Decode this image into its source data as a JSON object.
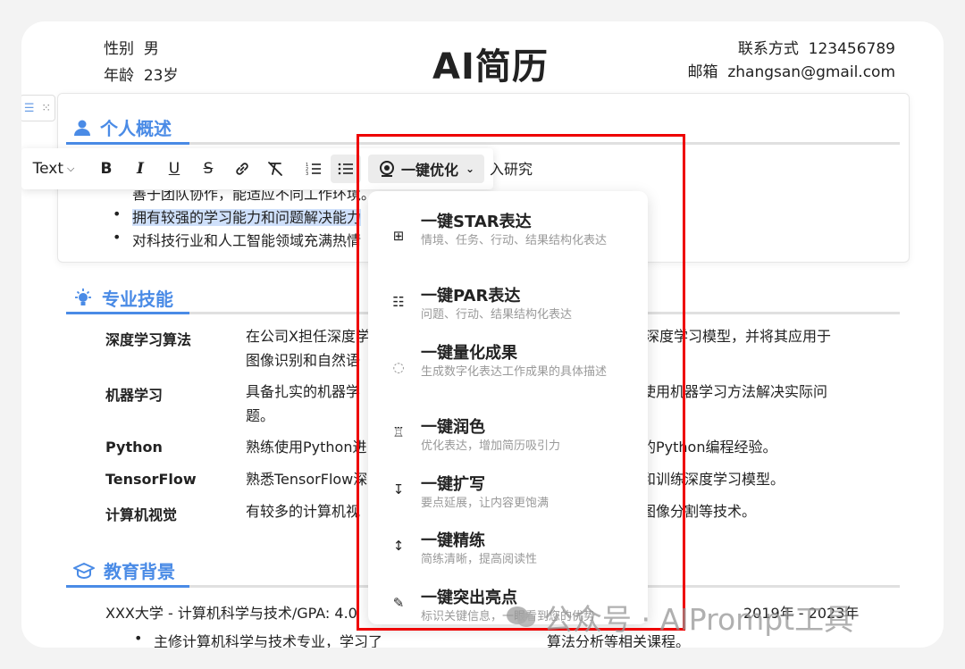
{
  "header": {
    "gender_label": "性别",
    "gender_value": "男",
    "age_label": "年龄",
    "age_value": "23岁",
    "title": "AI简历",
    "contact_label": "联系方式",
    "contact_value": "123456789",
    "email_label": "邮箱",
    "email_value": "zhangsan@gmail.com"
  },
  "block_handle": {
    "icon_a": "☰",
    "icon_b": "⁙"
  },
  "section_personal": {
    "title": "个人概述",
    "bullet_partial_top": "入研究",
    "bullets": [
      "善于团队协作，能适应不同工作环境。",
      "拥有较强的学习能力和问题解决能力",
      "对科技行业和人工智能领域充满热情"
    ]
  },
  "toolbar": {
    "text_label": "Text",
    "bold": "B",
    "italic": "I",
    "underline": "U",
    "strike": "S",
    "link_icon": "link-icon",
    "clear_icon": "clear-format-icon",
    "ordered_icon": "ordered-list-icon",
    "bullet_icon": "bullet-list-icon",
    "ai_label": "一键优化"
  },
  "section_skills": {
    "title": "专业技能",
    "items": [
      {
        "name": "深度学习算法",
        "desc_left": "在公司X担任深度学",
        "desc_left2": "图像识别和自然语",
        "desc_right": "建深度学习模型，并将其应用于"
      },
      {
        "name": "机器学习",
        "desc_left": "具备扎实的机器学",
        "desc_left2": "题。",
        "desc_right": "使用机器学习方法解决实际问"
      },
      {
        "name": "Python",
        "desc_left": "熟练使用Python进",
        "desc_right": "的Python编程经验。"
      },
      {
        "name": "TensorFlow",
        "desc_left": "熟悉TensorFlow深",
        "desc_right": "和训练深度学习模型。"
      },
      {
        "name": "计算机视觉",
        "desc_left": "有较多的计算机视",
        "desc_right": "图像分割等技术。"
      }
    ]
  },
  "section_edu": {
    "title": "教育背景",
    "school_line": "XXX大学 - 计算机科学与技术/GPA: 4.0",
    "date": "2019年 - 2023年",
    "bullet_left": "主修计算机科学与技术专业，学习了",
    "bullet_right": "算法分析等相关课程。"
  },
  "menu": {
    "items": [
      {
        "icon": "⊞",
        "icon_name": "grid-icon",
        "title": "一键STAR表达",
        "desc": "情境、任务、行动、结果结构化表达"
      },
      {
        "icon": "☷",
        "icon_name": "hierarchy-icon",
        "title": "一键PAR表达",
        "desc": "问题、行动、结果结构化表达"
      },
      {
        "icon": "◌",
        "icon_name": "quantify-icon",
        "title": "一键量化成果",
        "desc": "生成数字化表达工作成果的具体描述"
      },
      {
        "icon": "♖",
        "icon_name": "polish-icon",
        "title": "一键润色",
        "desc": "优化表达，增加简历吸引力"
      },
      {
        "icon": "↧",
        "icon_name": "expand-icon",
        "title": "一键扩写",
        "desc": "要点延展，让内容更饱满"
      },
      {
        "icon": "↕",
        "icon_name": "condense-icon",
        "title": "一键精练",
        "desc": "简练清晰，提高阅读性"
      },
      {
        "icon": "✎",
        "icon_name": "highlight-icon",
        "title": "一键突出亮点",
        "desc": "标识关键信息，一眼看到您的优势"
      }
    ]
  },
  "watermark": {
    "text": "公众号 · AIPrompt工具"
  },
  "colors": {
    "accent": "#4a8be6",
    "highlight": "#cfe0fb",
    "frame": "#ee0000"
  }
}
